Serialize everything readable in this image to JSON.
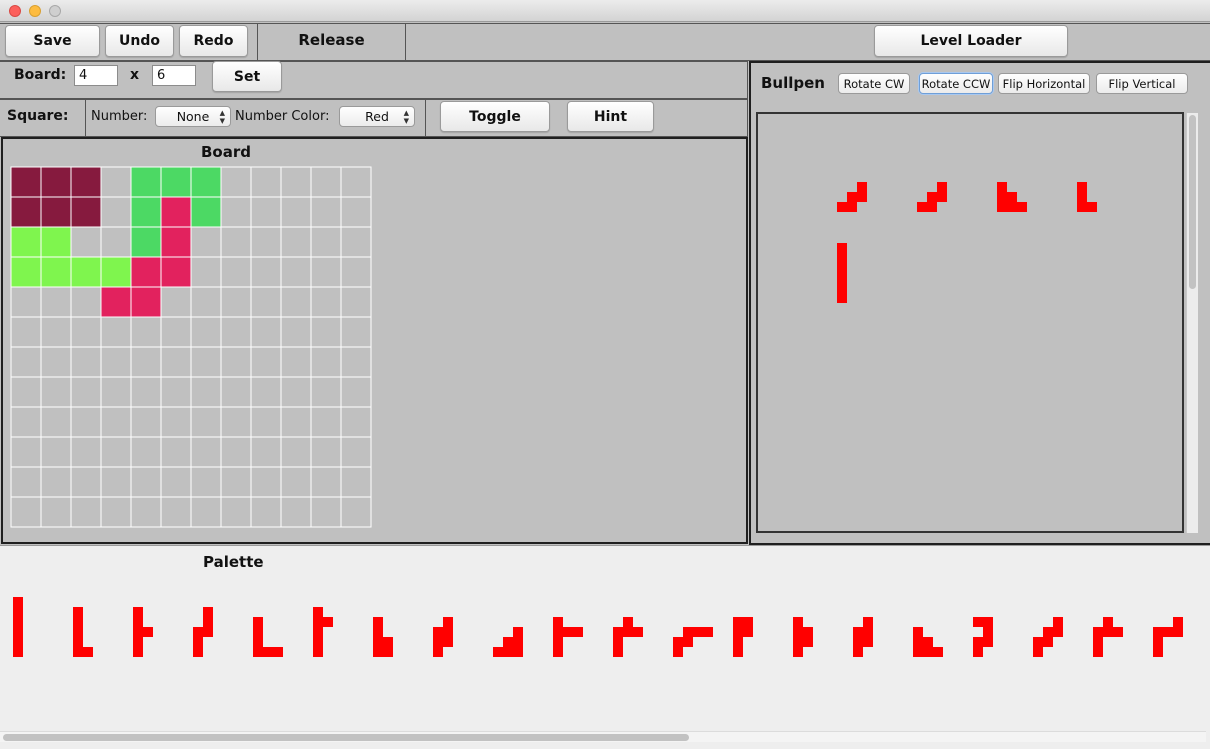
{
  "window": {
    "traffic_colors": [
      "#fc605c",
      "#fdbc40",
      "#cfcfcf"
    ]
  },
  "toolbar": {
    "save_label": "Save",
    "undo_label": "Undo",
    "redo_label": "Redo",
    "mode_label": "Release",
    "level_loader_label": "Level Loader"
  },
  "board_config": {
    "label": "Board:",
    "rows_value": "4",
    "separator": "x",
    "cols_value": "6",
    "set_label": "Set"
  },
  "square_config": {
    "label": "Square:",
    "number_label": "Number:",
    "number_value": "None",
    "number_color_label": "Number Color:",
    "number_color_value": "Red",
    "toggle_label": "Toggle",
    "hint_label": "Hint"
  },
  "board": {
    "title": "Board",
    "grid_rows": 12,
    "grid_cols": 12,
    "placed_pieces": [
      {
        "color": "#861a3e",
        "cells": [
          [
            0,
            0
          ],
          [
            0,
            1
          ],
          [
            0,
            2
          ],
          [
            1,
            0
          ],
          [
            1,
            1
          ],
          [
            1,
            2
          ]
        ]
      },
      {
        "color": "#4cd964",
        "cells": [
          [
            0,
            4
          ],
          [
            0,
            5
          ],
          [
            0,
            6
          ],
          [
            1,
            4
          ],
          [
            1,
            6
          ],
          [
            2,
            4
          ]
        ]
      },
      {
        "color": "#7ff54e",
        "cells": [
          [
            2,
            0
          ],
          [
            2,
            1
          ],
          [
            3,
            0
          ],
          [
            3,
            1
          ],
          [
            3,
            2
          ],
          [
            3,
            3
          ]
        ]
      },
      {
        "color": "#e2225e",
        "cells": [
          [
            1,
            5
          ],
          [
            2,
            5
          ],
          [
            3,
            4
          ],
          [
            3,
            5
          ],
          [
            4,
            3
          ],
          [
            4,
            4
          ]
        ]
      }
    ]
  },
  "bullpen": {
    "title": "Bullpen",
    "buttons": [
      "Rotate CW",
      "Rotate CCW",
      "Flip Horizontal",
      "Flip Vertical"
    ],
    "focused_button": "Rotate CCW",
    "piece_color": "#ff0000",
    "pieces": [
      [
        [
          0,
          2
        ],
        [
          1,
          1
        ],
        [
          1,
          2
        ],
        [
          2,
          0
        ],
        [
          2,
          1
        ]
      ],
      [
        [
          0,
          2
        ],
        [
          1,
          1
        ],
        [
          1,
          2
        ],
        [
          2,
          0
        ],
        [
          2,
          1
        ]
      ],
      [
        [
          0,
          0
        ],
        [
          1,
          0
        ],
        [
          1,
          1
        ],
        [
          2,
          0
        ],
        [
          2,
          1
        ],
        [
          2,
          2
        ]
      ],
      [
        [
          0,
          0
        ],
        [
          1,
          0
        ],
        [
          2,
          0
        ],
        [
          2,
          1
        ]
      ],
      [
        [
          0,
          0
        ],
        [
          1,
          0
        ],
        [
          2,
          0
        ],
        [
          3,
          0
        ],
        [
          4,
          0
        ],
        [
          5,
          0
        ]
      ]
    ]
  },
  "palette": {
    "title": "Palette",
    "piece_color": "#ff0000",
    "pieces": [
      [
        [
          0,
          0
        ],
        [
          1,
          0
        ],
        [
          2,
          0
        ],
        [
          3,
          0
        ],
        [
          4,
          0
        ],
        [
          5,
          0
        ]
      ],
      [
        [
          0,
          0
        ],
        [
          1,
          0
        ],
        [
          2,
          0
        ],
        [
          3,
          0
        ],
        [
          4,
          0
        ],
        [
          4,
          1
        ]
      ],
      [
        [
          0,
          0
        ],
        [
          1,
          0
        ],
        [
          2,
          0
        ],
        [
          2,
          1
        ],
        [
          3,
          0
        ],
        [
          4,
          0
        ]
      ],
      [
        [
          0,
          1
        ],
        [
          1,
          1
        ],
        [
          2,
          0
        ],
        [
          2,
          1
        ],
        [
          3,
          0
        ],
        [
          4,
          0
        ]
      ],
      [
        [
          0,
          0
        ],
        [
          1,
          0
        ],
        [
          2,
          0
        ],
        [
          3,
          0
        ],
        [
          3,
          1
        ],
        [
          3,
          2
        ]
      ],
      [
        [
          0,
          0
        ],
        [
          1,
          0
        ],
        [
          1,
          1
        ],
        [
          2,
          0
        ],
        [
          3,
          0
        ],
        [
          4,
          0
        ]
      ],
      [
        [
          0,
          0
        ],
        [
          1,
          0
        ],
        [
          2,
          0
        ],
        [
          2,
          1
        ],
        [
          3,
          0
        ],
        [
          3,
          1
        ]
      ],
      [
        [
          0,
          1
        ],
        [
          1,
          0
        ],
        [
          1,
          1
        ],
        [
          2,
          0
        ],
        [
          2,
          1
        ],
        [
          3,
          0
        ]
      ],
      [
        [
          0,
          2
        ],
        [
          1,
          1
        ],
        [
          1,
          2
        ],
        [
          2,
          0
        ],
        [
          2,
          1
        ],
        [
          2,
          2
        ]
      ],
      [
        [
          0,
          0
        ],
        [
          1,
          0
        ],
        [
          1,
          1
        ],
        [
          1,
          2
        ],
        [
          2,
          0
        ],
        [
          3,
          0
        ]
      ],
      [
        [
          0,
          1
        ],
        [
          1,
          0
        ],
        [
          1,
          1
        ],
        [
          1,
          2
        ],
        [
          2,
          0
        ],
        [
          3,
          0
        ]
      ],
      [
        [
          0,
          1
        ],
        [
          0,
          2
        ],
        [
          0,
          3
        ],
        [
          1,
          0
        ],
        [
          1,
          1
        ],
        [
          2,
          0
        ]
      ],
      [
        [
          0,
          0
        ],
        [
          0,
          1
        ],
        [
          1,
          0
        ],
        [
          1,
          1
        ],
        [
          2,
          0
        ],
        [
          3,
          0
        ]
      ],
      [
        [
          0,
          0
        ],
        [
          1,
          0
        ],
        [
          1,
          1
        ],
        [
          2,
          0
        ],
        [
          2,
          1
        ],
        [
          3,
          0
        ]
      ],
      [
        [
          0,
          1
        ],
        [
          1,
          0
        ],
        [
          1,
          1
        ],
        [
          2,
          0
        ],
        [
          2,
          1
        ],
        [
          3,
          0
        ]
      ],
      [
        [
          0,
          0
        ],
        [
          1,
          0
        ],
        [
          1,
          1
        ],
        [
          2,
          0
        ],
        [
          2,
          1
        ],
        [
          2,
          2
        ]
      ],
      [
        [
          0,
          0
        ],
        [
          0,
          1
        ],
        [
          1,
          1
        ],
        [
          2,
          0
        ],
        [
          2,
          1
        ],
        [
          3,
          0
        ]
      ],
      [
        [
          0,
          2
        ],
        [
          1,
          1
        ],
        [
          1,
          2
        ],
        [
          2,
          0
        ],
        [
          2,
          1
        ],
        [
          3,
          0
        ]
      ],
      [
        [
          0,
          1
        ],
        [
          1,
          0
        ],
        [
          1,
          1
        ],
        [
          1,
          2
        ],
        [
          2,
          0
        ],
        [
          3,
          0
        ]
      ],
      [
        [
          0,
          2
        ],
        [
          1,
          0
        ],
        [
          1,
          1
        ],
        [
          1,
          2
        ],
        [
          2,
          0
        ],
        [
          3,
          0
        ]
      ]
    ]
  }
}
